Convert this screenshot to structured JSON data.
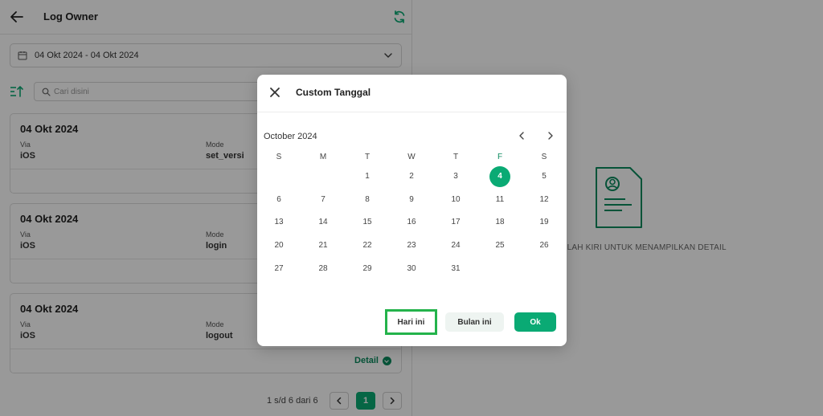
{
  "header": {
    "title": "Log Owner"
  },
  "date_filter": {
    "value": "04 Okt 2024 - 04 Okt 2024"
  },
  "search": {
    "placeholder": "Cari disini"
  },
  "labels": {
    "via": "Via",
    "mode": "Mode",
    "detail": "Detail"
  },
  "cards": [
    {
      "date": "04 Okt 2024",
      "via": "iOS",
      "mode": "set_versi"
    },
    {
      "date": "04 Okt 2024",
      "via": "iOS",
      "mode": "login"
    },
    {
      "date": "04 Okt 2024",
      "via": "iOS",
      "mode": "logout"
    }
  ],
  "pagination": {
    "info": "1 s/d 6 dari 6",
    "current_page": "1"
  },
  "right_panel": {
    "empty_message": "USER DI SEBELAH KIRI UNTUK MENAMPILKAN DETAIL"
  },
  "modal": {
    "title": "Custom Tanggal",
    "month_label": "October 2024",
    "weekdays": [
      "S",
      "M",
      "T",
      "W",
      "T",
      "F",
      "S"
    ],
    "selected_day": "4",
    "days": [
      "1",
      "2",
      "3",
      "4",
      "5",
      "6",
      "7",
      "8",
      "9",
      "10",
      "11",
      "12",
      "13",
      "14",
      "15",
      "16",
      "17",
      "18",
      "19",
      "20",
      "21",
      "22",
      "23",
      "24",
      "25",
      "26",
      "27",
      "28",
      "29",
      "30",
      "31"
    ],
    "buttons": {
      "today": "Hari ini",
      "this_month": "Bulan ini",
      "ok": "Ok"
    }
  },
  "colors": {
    "accent": "#0aaa74",
    "accent_dark": "#0a8a5e",
    "highlight": "#24b34b",
    "overlay": "rgba(0,0,0,0.4)"
  },
  "icons": [
    "back-arrow-icon",
    "refresh-icon",
    "calendar-icon",
    "chevron-down-icon",
    "sort-icon",
    "search-icon",
    "detail-arrow-icon",
    "chevron-left-icon",
    "chevron-right-icon",
    "document-user-icon",
    "close-icon"
  ]
}
